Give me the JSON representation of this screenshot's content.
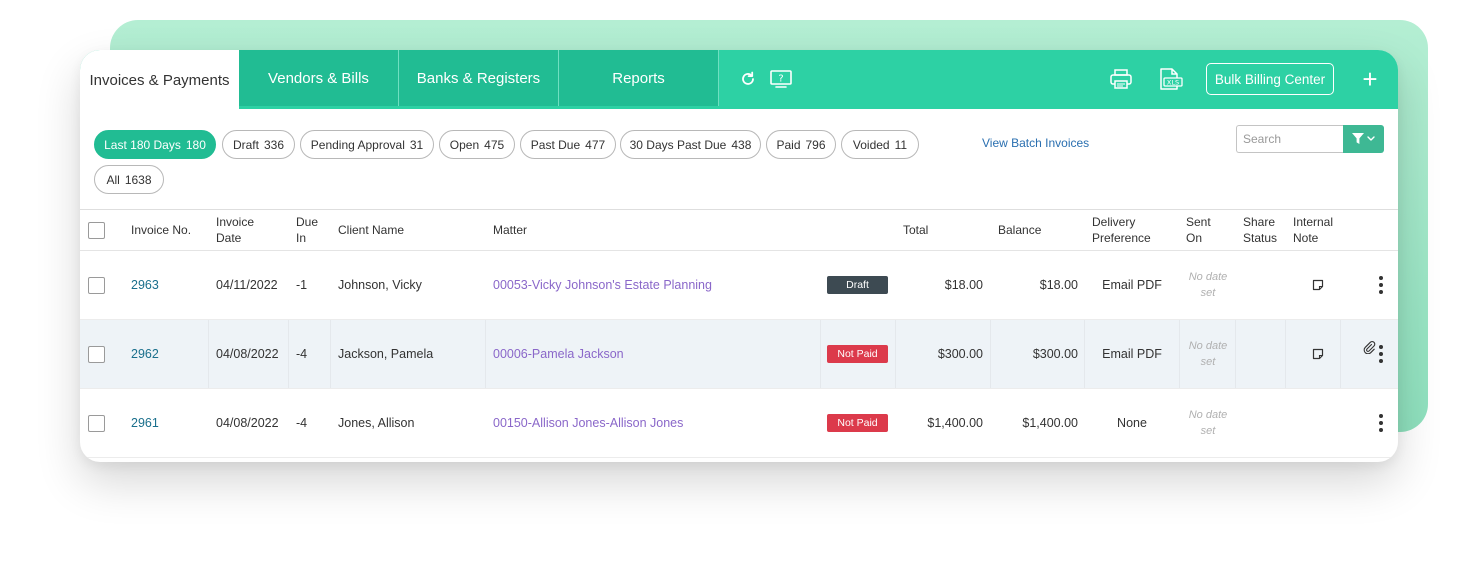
{
  "nav": {
    "active_tab": "Invoices & Payments",
    "tabs": [
      "Vendors & Bills",
      "Banks & Registers",
      "Reports"
    ],
    "icons": [
      "refresh-icon",
      "help-screen-icon",
      "print-icon",
      "xls-export-icon",
      "plus-icon"
    ],
    "bulk_billing": "Bulk Billing Center",
    "plus": "+"
  },
  "filters": [
    {
      "label": "Last 180 Days",
      "count": "180"
    },
    {
      "label": "Draft",
      "count": "336"
    },
    {
      "label": "Pending Approval",
      "count": "31"
    },
    {
      "label": "Open",
      "count": "475"
    },
    {
      "label": "Past Due",
      "count": "477"
    },
    {
      "label": "30 Days Past Due",
      "count": "438"
    },
    {
      "label": "Paid",
      "count": "796"
    },
    {
      "label": "Voided",
      "count": "11"
    },
    {
      "label": "All",
      "count": "1638"
    }
  ],
  "batch_link": "View Batch Invoices",
  "search": {
    "placeholder": "Search"
  },
  "table": {
    "headers": {
      "invoice_no": "Invoice No.",
      "invoice_date": "Invoice Date",
      "due_in": "Due In",
      "client_name": "Client Name",
      "matter": "Matter",
      "total": "Total",
      "balance": "Balance",
      "delivery": "Delivery Preference",
      "sent_on": "Sent On",
      "share_status": "Share Status",
      "internal_note": "Internal Note"
    },
    "rows": [
      {
        "invoice_no": "2963",
        "date": "04/11/2022",
        "due_in": "-1",
        "client": "Johnson, Vicky",
        "matter": "00053-Vicky Johnson's Estate Planning",
        "status": "Draft",
        "total": "$18.00",
        "balance": "$18.00",
        "delivery": "Email PDF",
        "sent_on": "No date set"
      },
      {
        "invoice_no": "2962",
        "date": "04/08/2022",
        "due_in": "-4",
        "client": "Jackson, Pamela",
        "matter": "00006-Pamela Jackson",
        "status": "Not Paid",
        "total": "$300.00",
        "balance": "$300.00",
        "delivery": "Email PDF",
        "sent_on": "No date set"
      },
      {
        "invoice_no": "2961",
        "date": "04/08/2022",
        "due_in": "-4",
        "client": "Jones, Allison",
        "matter": "00150-Allison Jones-Allison Jones",
        "status": "Not Paid",
        "total": "$1,400.00",
        "balance": "$1,400.00",
        "delivery": "None",
        "sent_on": "No date set"
      }
    ]
  },
  "colors": {
    "brand": "#2dd1a4",
    "brand_dark": "#21bc93",
    "draft": "#3d4a52",
    "not_paid": "#dc3a4b"
  }
}
